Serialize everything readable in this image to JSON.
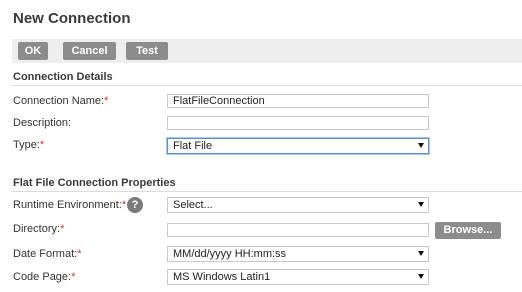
{
  "window": {
    "title": "New Connection"
  },
  "toolbar": {
    "ok_label": "OK",
    "cancel_label": "Cancel",
    "test_label": "Test"
  },
  "connection_details": {
    "heading": "Connection Details",
    "name": {
      "label": "Connection Name:",
      "required": "*",
      "value": "FlatFileConnection"
    },
    "description": {
      "label": "Description:",
      "value": ""
    },
    "type": {
      "label": "Type:",
      "required": "*",
      "selected": "Flat File"
    }
  },
  "flat_file_properties": {
    "heading": "Flat File Connection Properties",
    "runtime_environment": {
      "label": "Runtime Environment:",
      "required": "*",
      "selected": "Select...",
      "help_icon": "?"
    },
    "directory": {
      "label": "Directory:",
      "required": "*",
      "value": "",
      "browse_label": "Browse..."
    },
    "date_format": {
      "label": "Date Format:",
      "required": "*",
      "selected": "MM/dd/yyyy HH:mm:ss"
    },
    "code_page": {
      "label": "Code Page:",
      "required": "*",
      "selected": "MS Windows Latin1"
    }
  },
  "colors": {
    "button_bg": "#8c8c8c",
    "toolbar_bg": "#eeeeee",
    "required": "#cc3333",
    "focus": "#5b8fd6"
  },
  "icons": {
    "help": "question-circle-icon",
    "dropdown": "chevron-down-icon"
  }
}
